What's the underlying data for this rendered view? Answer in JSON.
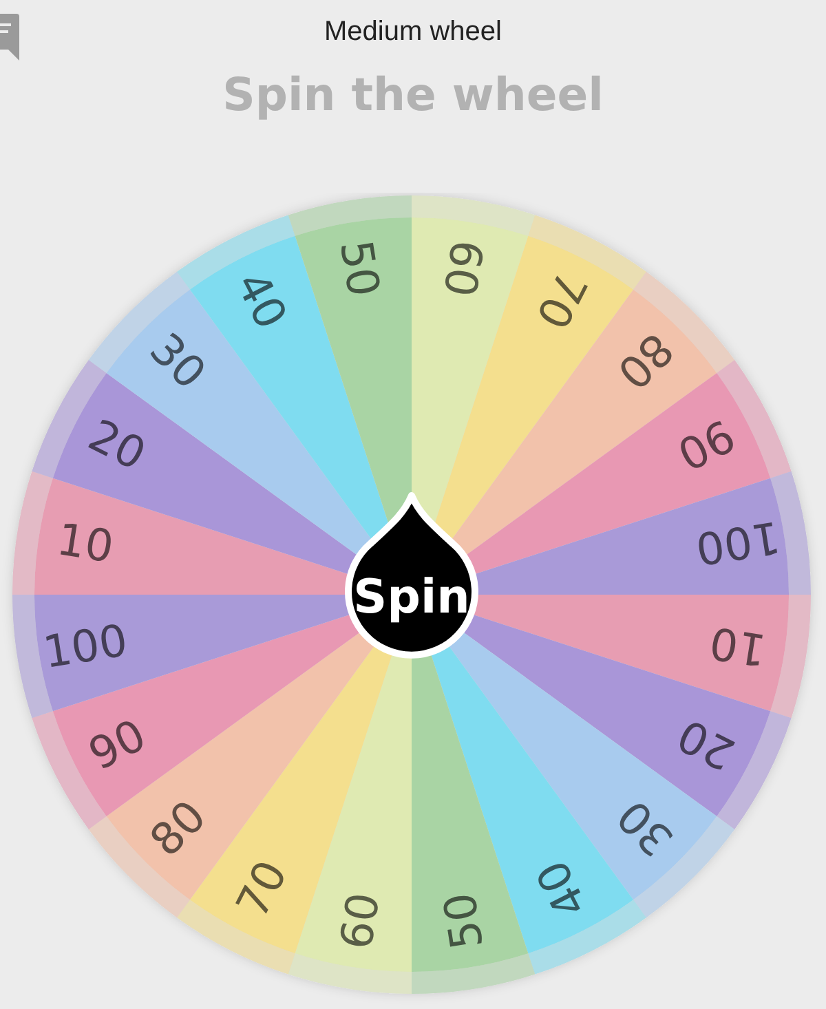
{
  "header": {
    "title": "Medium wheel",
    "heading": "Spin the wheel"
  },
  "wheel": {
    "button": "Spin",
    "segments": [
      {
        "label": "60",
        "color": "#dfeab2"
      },
      {
        "label": "70",
        "color": "#f4df8e"
      },
      {
        "label": "80",
        "color": "#f2c2ab"
      },
      {
        "label": "90",
        "color": "#e898b3"
      },
      {
        "label": "100",
        "color": "#a99ad8"
      },
      {
        "label": "10",
        "color": "#e79db2"
      },
      {
        "label": "20",
        "color": "#a996d8"
      },
      {
        "label": "30",
        "color": "#a8cbee"
      },
      {
        "label": "40",
        "color": "#7fdcf0"
      },
      {
        "label": "50",
        "color": "#a9d4a4"
      },
      {
        "label": "60",
        "color": "#dfeab2"
      },
      {
        "label": "70",
        "color": "#f4df8e"
      },
      {
        "label": "80",
        "color": "#f2c2ab"
      },
      {
        "label": "90",
        "color": "#e898b3"
      },
      {
        "label": "100",
        "color": "#a99ad8"
      },
      {
        "label": "10",
        "color": "#e79db2"
      },
      {
        "label": "20",
        "color": "#a996d8"
      },
      {
        "label": "30",
        "color": "#a8cbee"
      },
      {
        "label": "40",
        "color": "#7fdcf0"
      },
      {
        "label": "50",
        "color": "#a9d4a4"
      }
    ]
  }
}
